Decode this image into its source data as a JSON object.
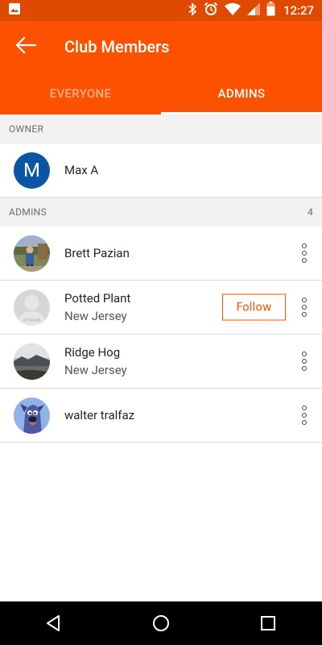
{
  "status_bar": {
    "time": "12:27",
    "left_icons": [
      "image-icon"
    ],
    "right_icons": [
      "bluetooth-icon",
      "alarm-icon",
      "wifi-icon",
      "signal-icon",
      "battery-icon"
    ]
  },
  "header": {
    "title": "Club Members",
    "back_icon": "arrow-left-icon",
    "tabs": [
      {
        "label": "EVERYONE",
        "active": false
      },
      {
        "label": "ADMINS",
        "active": true
      }
    ]
  },
  "owner_section": {
    "header": "OWNER",
    "member": {
      "avatar_letter": "M",
      "name": "Max A",
      "location": ""
    }
  },
  "admins_section": {
    "header": "ADMINS",
    "count": "4",
    "members": [
      {
        "name": "Brett Pazian",
        "location": "",
        "avatar": "photo-person-avatar"
      },
      {
        "name": "Potted Plant",
        "location": "New Jersey",
        "avatar": "strava-default-avatar",
        "follow_label": "Follow"
      },
      {
        "name": "Ridge Hog",
        "location": "New Jersey",
        "avatar": "landscape-photo-avatar"
      },
      {
        "name": "walter tralfaz",
        "location": "",
        "avatar": "cartoon-dog-avatar"
      }
    ]
  },
  "colors": {
    "status_bar": "#e04a00",
    "app_bar": "#fc5200",
    "owner_avatar": "#0b56a4",
    "follow_border": "#fc5200"
  },
  "nav": {
    "icons": [
      "back-triangle-icon",
      "home-circle-icon",
      "recents-square-icon"
    ]
  }
}
